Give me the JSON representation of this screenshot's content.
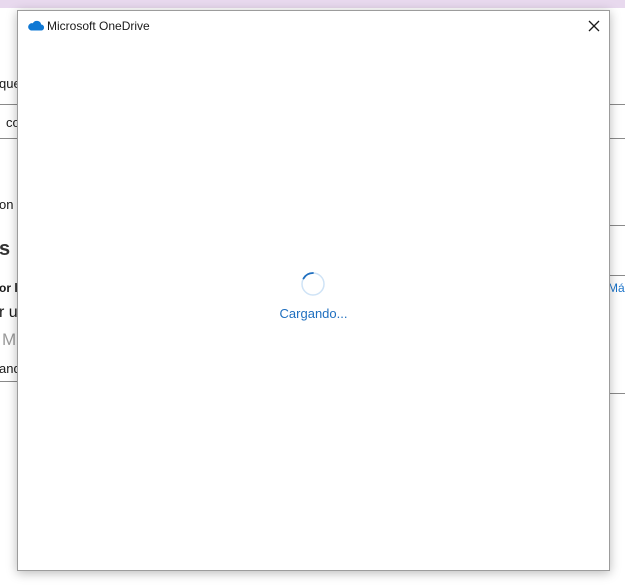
{
  "background": {
    "fragments": [
      {
        "text": "que"
      },
      {
        "text": "co"
      },
      {
        "text": "on d"
      },
      {
        "text": "s"
      },
      {
        "text": "or l"
      },
      {
        "text": "r ur"
      },
      {
        "text": "Mi"
      },
      {
        "text": "and"
      },
      {
        "text": "Más"
      }
    ]
  },
  "dialog": {
    "title": "Microsoft OneDrive",
    "loading_text": "Cargando...",
    "icons": {
      "app": "onedrive-cloud-icon",
      "close": "close-icon",
      "spinner": "loading-spinner-icon"
    },
    "colors": {
      "accent": "#1f6fbf",
      "cloud": "#0f78d4"
    }
  }
}
